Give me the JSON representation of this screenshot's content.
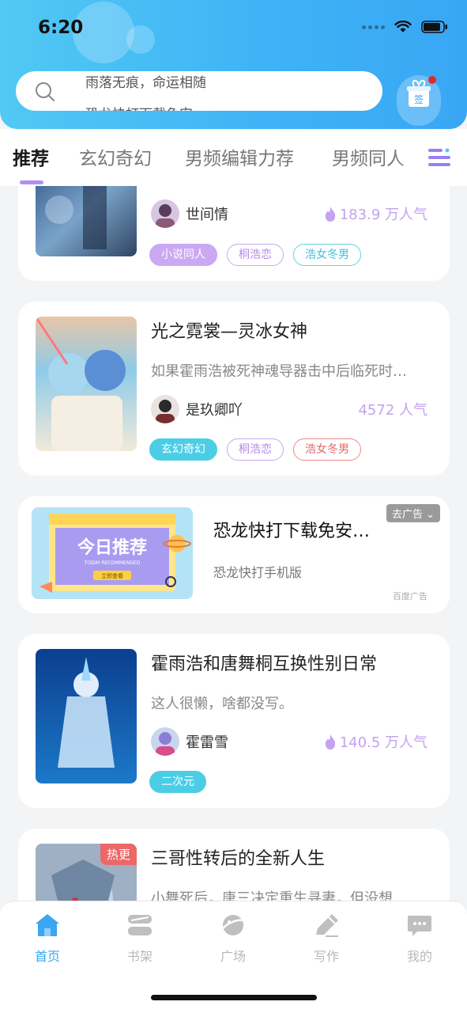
{
  "status": {
    "time": "6:20"
  },
  "search": {
    "text_line1": "雨落无痕，命运相随",
    "text_line2": "恐龙快打下载免安"
  },
  "sign": {
    "label": "签"
  },
  "tabs": [
    {
      "label": "推荐"
    },
    {
      "label": "玄幻奇幻"
    },
    {
      "label": "男频编辑力荐"
    },
    {
      "label": "男频同人"
    }
  ],
  "cards": [
    {
      "author": "世间情",
      "popularity": "183.9 万人气",
      "tags": [
        "小说同人",
        "桐浩恋",
        "浩女冬男"
      ]
    },
    {
      "title": "光之霓裳—灵冰女神",
      "desc": "如果霍雨浩被死神魂导器击中后临死时…",
      "author": "是玖卿吖",
      "popularity": "4572 人气",
      "tags": [
        "玄幻奇幻",
        "桐浩恋",
        "浩女冬男"
      ]
    },
    {
      "title": "霍雨浩和唐舞桐互换性别日常",
      "desc": "这人很懒，啥都没写。",
      "author": "霍雷雪",
      "popularity": "140.5 万人气",
      "tags": [
        "二次元"
      ]
    },
    {
      "title": "三哥性转后的全新人生",
      "desc": "小舞死后，唐三决定重生寻妻，但没想…",
      "badge": "热更"
    }
  ],
  "ad": {
    "title": "恐龙快打下载免安…",
    "subtitle": "恐龙快打手机版",
    "close_label": "去广告",
    "source": "百度广告",
    "image_text": "今日推荐",
    "image_subtext": "TODAY RECOMMENDED",
    "image_button": "立即查看"
  },
  "nav": [
    {
      "label": "首页"
    },
    {
      "label": "书架"
    },
    {
      "label": "广场"
    },
    {
      "label": "写作"
    },
    {
      "label": "我的"
    }
  ],
  "colors": {
    "accent": "#3ba6f2",
    "header": "#42b8f5",
    "tag_purple": "#caa8f2",
    "tag_cyan": "#4ccde6"
  }
}
